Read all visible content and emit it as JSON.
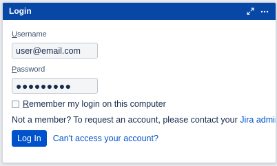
{
  "header": {
    "title": "Login",
    "expand_icon": "expand-icon",
    "more_icon": "more-options-icon"
  },
  "form": {
    "username_label_prefix": "U",
    "username_label_rest": "sername",
    "username_value": "user@email.com",
    "password_label_prefix": "P",
    "password_label_rest": "assword",
    "password_value": "●●●●●●●●●",
    "remember_label_prefix": "R",
    "remember_label_rest": "emember my login on this computer",
    "remember_checked": false
  },
  "member_notice": {
    "text": "Not a member? To request an account, please contact your ",
    "link": "Jira administrators",
    "suffix": "."
  },
  "actions": {
    "login_button": "Log In",
    "cant_access_link": "Can't access your account?"
  },
  "colors": {
    "header_bg": "#0747a6",
    "primary": "#0052cc",
    "link": "#0052cc"
  }
}
